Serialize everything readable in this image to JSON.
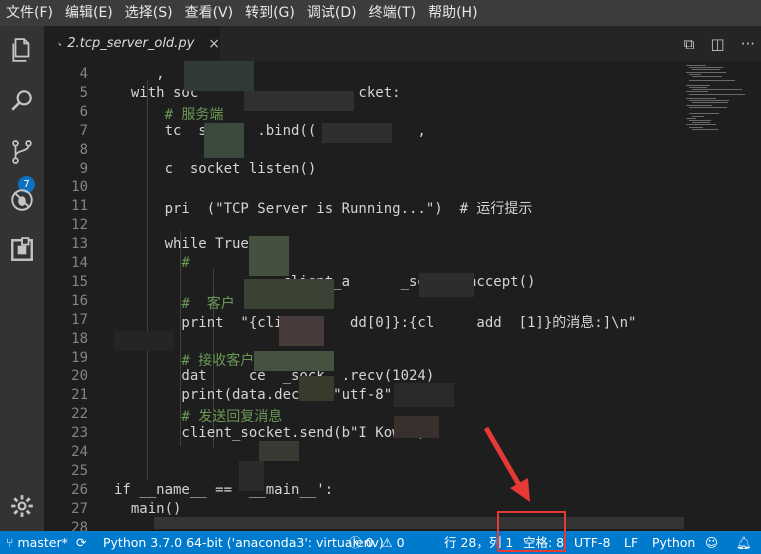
{
  "menubar": {
    "items": [
      "文件(F)",
      "编辑(E)",
      "选择(S)",
      "查看(V)",
      "转到(G)",
      "调试(D)",
      "终端(T)",
      "帮助(H)"
    ]
  },
  "activity": {
    "scm_badge": "7",
    "icons": [
      "files-icon",
      "search-icon",
      "source-control-icon",
      "debug-icon",
      "extensions-icon",
      "settings-gear-icon"
    ]
  },
  "tab": {
    "name": "2.tcp_server_old.py",
    "close": "×"
  },
  "editor": {
    "line_numbers": [
      "4",
      "5",
      "6",
      "7",
      "8",
      "9",
      "10",
      "11",
      "12",
      "13",
      "14",
      "15",
      "16",
      "17",
      "18",
      "19",
      "20",
      "21",
      "22",
      "23",
      "24",
      "25",
      "26",
      "27",
      "28"
    ],
    "lines": [
      "     ,   \"  ).",
      "  with soc                   cket:",
      "      # 服务端        ",
      "      tc  socke  .bind((            ,",
      "",
      "      c  socket listen()",
      "",
      "      pri  (\"TCP Server is Running...\")  # 运行提示",
      "",
      "      while True:",
      "        #  ",
      "                  , client_a      _socket.accept()",
      "        #  客户  提示",
      "        print  \"{cli        dd[0]}:{cl     add  [1]}的消息:]\\n\"",
      "",
      "        # 接收客户端  消息",
      "        dat     ce  _sock  .recv(1024)",
      "        print(data.decode(\"utf-8\"))",
      "        # 发送回复消息",
      "        client_socket.send(b\"I Kown\")",
      "",
      "",
      "if __name__ == '__main__':",
      "  main()",
      ""
    ]
  },
  "statusbar": {
    "branch": "master*",
    "interpreter": "Python 3.7.0 64-bit ('anaconda3': virtualenv)",
    "errors": "0",
    "warnings": "0",
    "position": "行 28，列 1",
    "spaces": "空格: 8",
    "encoding": "UTF-8",
    "eol": "LF",
    "language": "Python"
  },
  "colors": {
    "accent": "#007acc",
    "highlight": "#e53935"
  }
}
